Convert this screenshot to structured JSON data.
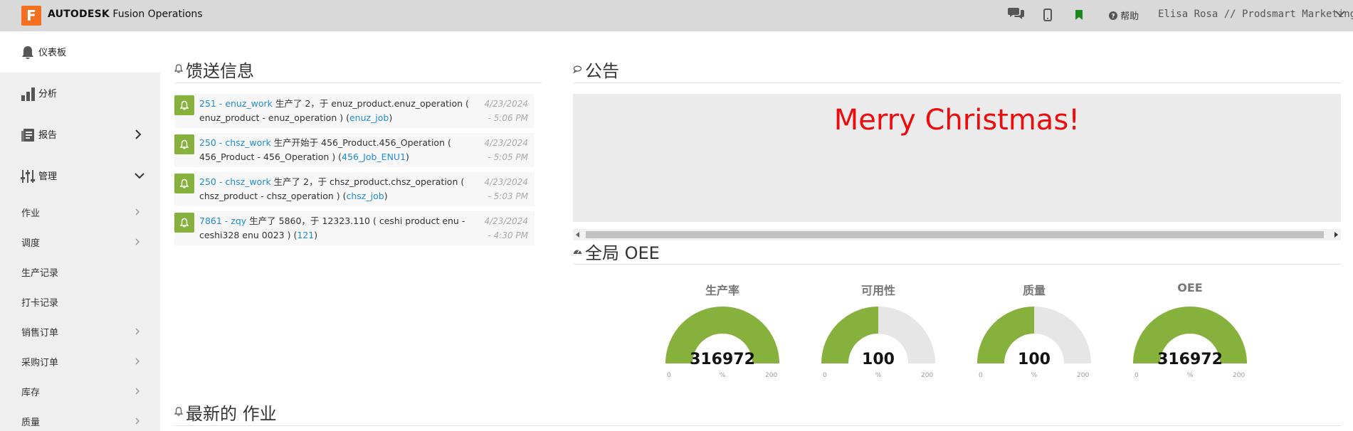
{
  "topbar": {
    "logo_letter": "F",
    "brand_bold": "AUTODESK",
    "brand_rest": " Fusion Operations",
    "help_label": "帮助",
    "user_label": "Elisa Rosa // Prodsmart Marketing"
  },
  "sidebar": {
    "main": [
      {
        "label": "仪表板",
        "icon": "bell-icon",
        "active": true
      },
      {
        "label": "分析",
        "icon": "bar-chart-icon"
      },
      {
        "label": "报告",
        "icon": "report-icon"
      },
      {
        "label": "管理",
        "icon": "sliders-icon"
      }
    ],
    "sub": [
      {
        "label": "作业"
      },
      {
        "label": "调度"
      },
      {
        "label": "生产记录"
      },
      {
        "label": "打卡记录"
      },
      {
        "label": "销售订单"
      },
      {
        "label": "采购订单"
      },
      {
        "label": "库存"
      },
      {
        "label": "质量"
      }
    ]
  },
  "feed": {
    "title": "馈送信息",
    "items": [
      {
        "link1": "251 - enuz_work",
        "t1": " 生产了 2，于 enuz_product.enuz_operation ( enuz_product - enuz_operation ) (",
        "link2": "enuz_job",
        "t2": ")",
        "date": "4/23/2024",
        "time": "- 5:06 PM"
      },
      {
        "link1": "250 - chsz_work",
        "t1": " 生产开始于 456_Product.456_Operation ( 456_Product - 456_Operation ) (",
        "link2": "456_Job_ENU1",
        "t2": ")",
        "date": "4/23/2024",
        "time": "- 5:05 PM"
      },
      {
        "link1": "250 - chsz_work",
        "t1": " 生产了 2，于 chsz_product.chsz_operation ( chsz_product - chsz_operation ) (",
        "link2": "chsz_job",
        "t2": ")",
        "date": "4/23/2024",
        "time": "- 5:03 PM"
      },
      {
        "link1": "7861 - zqy",
        "t1": " 生产了 5860，于 12323.110 ( ceshi product enu - ceshi328 enu 0023 ) (",
        "link2": "121",
        "t2": ")",
        "date": "4/23/2024",
        "time": "- 4:30 PM"
      }
    ]
  },
  "announcement": {
    "title": "公告",
    "message": "Merry Christmas!",
    "message_color": "#ee0b0b"
  },
  "oee": {
    "title": "全局 OEE",
    "gauges": [
      {
        "label": "生产率",
        "value": "316972",
        "min": "0",
        "max": "200",
        "unit": "%",
        "fill_fraction": 1.0
      },
      {
        "label": "可用性",
        "value": "100",
        "min": "0",
        "max": "200",
        "unit": "%",
        "fill_fraction": 0.5
      },
      {
        "label": "质量",
        "value": "100",
        "min": "0",
        "max": "200",
        "unit": "%",
        "fill_fraction": 0.5
      },
      {
        "label": "OEE",
        "value": "316972",
        "min": "0",
        "max": "200",
        "unit": "%",
        "fill_fraction": 1.0
      }
    ],
    "fill_color": "#86b13c",
    "track_color": "#e6e6e6"
  },
  "jobs": {
    "title": "最新的 作业"
  }
}
